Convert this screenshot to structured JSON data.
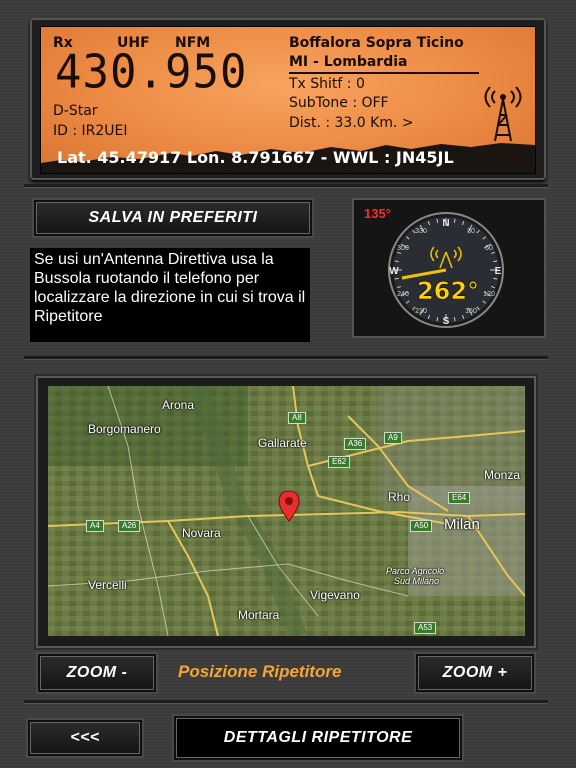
{
  "lcd": {
    "rx": "Rx",
    "band": "UHF",
    "mode": "NFM",
    "frequency": "430.950",
    "digital_mode": "D-Star",
    "id_line": "ID : IR2UEI",
    "location_line1": "Boffalora Sopra Ticino",
    "location_line2": "MI - Lombardia",
    "tx_shift": "Tx Shitf : 0",
    "subtone": "SubTone : OFF",
    "distance": "Dist. : 33.0 Km. >",
    "coordinates": "Lat. 45.47917  Lon. 8.791667 - WWL : JN45JL",
    "tower_icon": "radio-tower-icon"
  },
  "buttons": {
    "save_favorites": "SALVA IN PREFERITI",
    "zoom_out": "ZOOM -",
    "zoom_in": "ZOOM +",
    "back": "<<<",
    "details": "DETTAGLI RIPETITORE"
  },
  "info_text": "Se usi un'Antenna Direttiva usa la Bussola ruotando il telefono per localizzare la direzione in cui si trova il Ripetitore",
  "compass": {
    "phone_heading": "135°",
    "bearing": "262°",
    "cardinals": {
      "n": "N",
      "e": "E",
      "s": "S",
      "w": "W"
    },
    "ticks": [
      "30",
      "60",
      "120",
      "150",
      "210",
      "240",
      "300",
      "330"
    ],
    "colors": {
      "bearing": "#ffd000",
      "heading": "#ff2a2a"
    }
  },
  "map": {
    "cities": [
      "Arona",
      "Borgomanero",
      "Gallarate",
      "Monza",
      "Rho",
      "Milan",
      "Novara",
      "Vercelli",
      "Vigevano",
      "Mortara",
      "Parco Agricolo",
      "Sud Milano"
    ],
    "roads": [
      "A8",
      "A36",
      "A9",
      "E62",
      "A4",
      "A26",
      "E64",
      "A50",
      "A53"
    ],
    "marker_icon": "map-pin-icon"
  },
  "map_caption": "Posizione Ripetitore",
  "colors": {
    "lcd": "#ec8a44",
    "caption": "#f0a63a",
    "background": "#3b3b3b"
  }
}
